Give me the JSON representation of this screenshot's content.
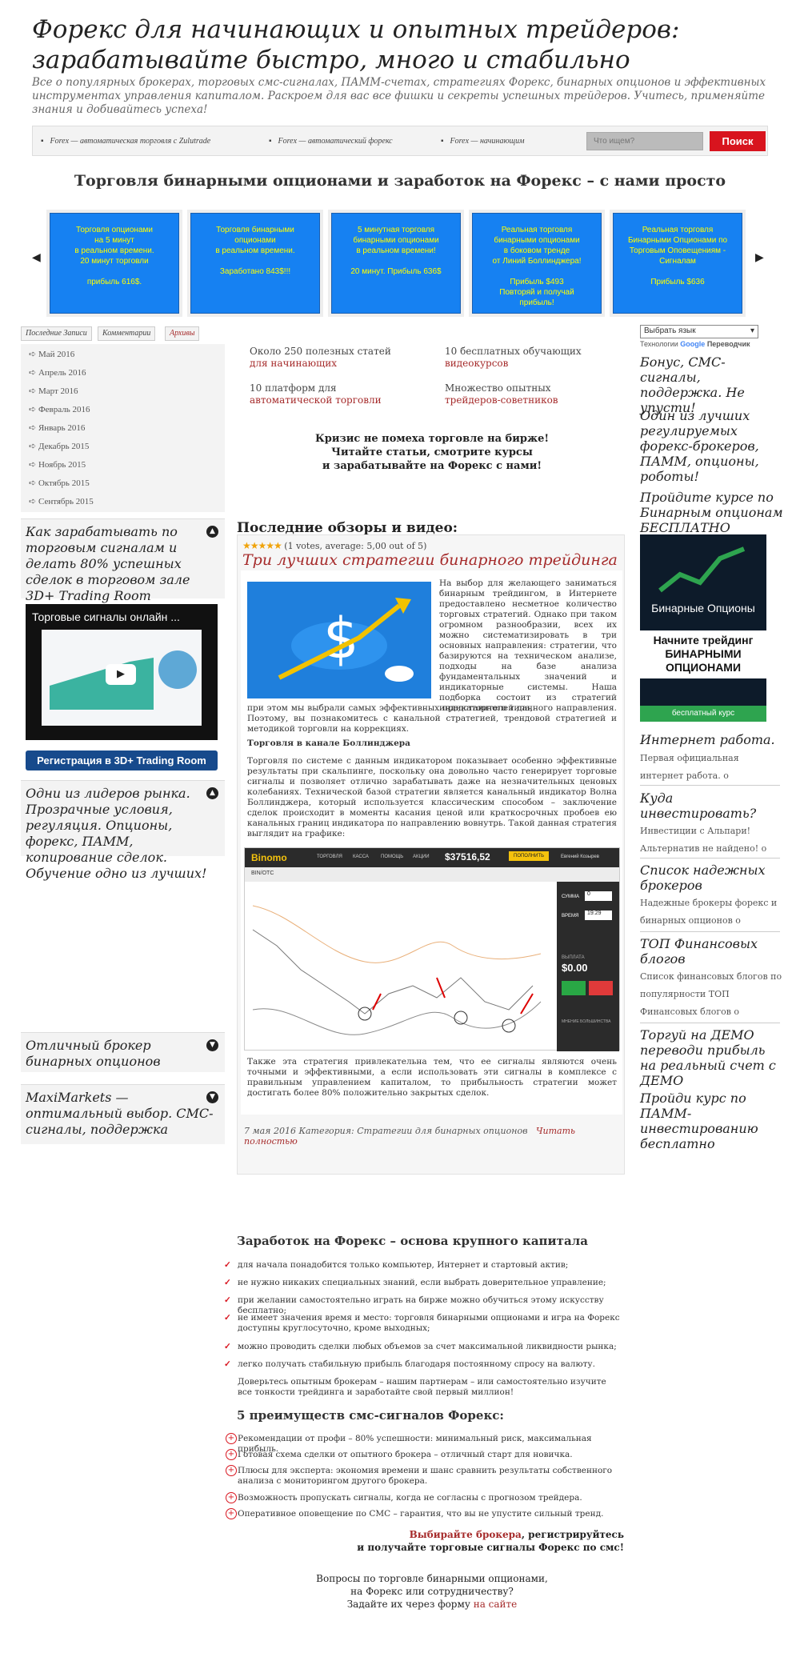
{
  "site": {
    "title": "Форекс для начинающих и опытных трейдеров: зарабатывайте быстро, много и стабильно",
    "description": "Все о популярных брокерах, торговых смс-сигналах, ПАММ-счетах, стратегиях Форекс, бинарных опционов и эффективных инструментах управления капиталом. Раскроем для вас все фишки и секреты успешных трейдеров. Учитесь, применяйте знания и добивайтесь успеха!"
  },
  "nav": {
    "items": [
      "Forex — автоматическая торговля с Zulutrade",
      "Forex — автоматический форекс",
      "Forex — начинающим"
    ],
    "search_placeholder": "Что ищем?",
    "search_button": "Поиск"
  },
  "headline": "Торговля бинарными опционами и заработок на Форекс – с нами просто",
  "carousel": {
    "prev": "◀",
    "next": "▶",
    "slides": [
      "Торговля опционами\nна 5 минут\nв реальном времени.\n20 минут торговли\n\nприбыль 616$.",
      "Торговля бинарными\nопционами\nв реальном времени.\n\nЗаработано 843$!!!",
      "5 минутная торговля\nбинарными опционами\nв реальном времени!\n\n20 минут. Прибыль 636$",
      "Реальная торговля\nбинарными опционами\nв боковом тренде\nот Линий Боллинджера!\n\nПрибыль $493\nПовторяй и получай\nприбыль!",
      "Реальная торговля\nБинарными Опционами по\nТорговым Оповещениям -\nСигналам\n\nПрибыль $636"
    ]
  },
  "left": {
    "tabs": [
      "Последние Записи",
      "Комментарии",
      "Архивы"
    ],
    "archives": [
      "Май 2016",
      "Апрель 2016",
      "Март 2016",
      "Февраль 2016",
      "Январь 2016",
      "Декабрь 2015",
      "Ноябрь 2015",
      "Октябрь 2015",
      "Сентябрь 2015"
    ],
    "widget1_title": "Как зарабатывать по торговым сигналам и делать 80% успешных сделок в торговом зале 3D+ Trading Room",
    "video_title": "Торговые сигналы онлайн ...",
    "register_button": "Регистрация в 3D+ Trading Room",
    "widget2_title": "Одни из лидеров рынка. Прозрачные условия, регуляция. Опционы, форекс, ПАММ, копирование сделок. Обучение одно из лучших!",
    "widget3_title": "Отличный брокер бинарных опционов",
    "widget4_title": "MaxiMarkets — оптимальный выбор. СМС-сигналы, поддержка"
  },
  "stats": {
    "s1_text": "Около 250 полезных статей ",
    "s1_link": "для начинающих",
    "s2_text": "10 бесплатных обучающих ",
    "s2_link": "видеокурсов",
    "s3_text": "10 платформ для ",
    "s3_link": "автоматической торговли",
    "s4_text": "Множество опытных ",
    "s4_link": "трейдеров-советников"
  },
  "crisis": {
    "line1": "Кризис не помеха торговле на бирже!",
    "line2": "Читайте статьи, смотрите курсы",
    "line3": "и зарабатывайте на Форекс с нами!"
  },
  "reviews": {
    "title": "Последние обзоры и видео:",
    "stars": "★★★★★",
    "rating_text": "(1 votes, average: 5,00 out of 5)",
    "post_title": "Три лучших стратегии бинарного трейдинга",
    "para1": "На выбор для желающего заниматься бинарным трейдингом, в Интернете предоставлено несметное количество торговых стратегий. Однако при таком огромном разнообразии, всех их можно систематизировать в три основных направления: стратегии, что базируются на техническом анализе, подходы на базе анализа фундаментальных значений и индикаторные системы. Наша подборка состоит из стратегий индикаторного типа,",
    "para1b": "при этом мы выбрали самых эффективных представителей данного направления. Поэтому, вы познакомитесь с канальной стратегией, трендовой стратегией и методикой торговли на коррекциях.",
    "subhead": "Торговля в канале Боллинджера",
    "para2": "Торговля по системе с данным индикатором показывает особенно эффективные результаты при скальпинге, поскольку она довольно часто генерирует торговые сигналы и позволяет отлично зарабатывать даже на незначительных ценовых колебаниях. Технической базой стратегии является канальный индикатор Волна Боллинджера, который используется классическим способом – заключение сделок происходит в моменты касания ценой или краткосрочных пробоев ею канальных границ индикатора по направлению вовнутрь. Такой данная стратегия выглядит на графике:",
    "chart_brand": "Binomo",
    "chart_menu": [
      "ТОРГОВЛЯ",
      "КАССА",
      "ПОМОЩЬ",
      "АКЦИИ"
    ],
    "chart_balance": "$37516,52",
    "chart_deposit": "ПОПОЛНИТЬ",
    "chart_user": "Евгений Козырев",
    "chart_symbol": "BIN/OTC",
    "chart_sum_label": "СУММА",
    "chart_sum_value": "0",
    "chart_time_label": "ВРЕМЯ",
    "chart_time_value": "19:29",
    "chart_payout_label": "ВЫПЛАТА",
    "chart_payout_value": "$0.00",
    "chart_mood_label": "МНЕНИЕ БОЛЬШИНСТВА",
    "para3": "Также эта стратегия привлекательна тем, что ее сигналы являются очень точными и эффективными, а если использовать эти сигналы в комплексе с правильным управлением капиталом, то прибыльность стратегии может достигать более 80% положительно закрытых сделок.",
    "meta": "7 мая 2016 Категория: Стратегии для бинарных опционов",
    "read_more": "Читать полностью"
  },
  "right": {
    "lang_select": "Выбрать язык",
    "lang_powered": "Технологии",
    "lang_brand": "Google",
    "lang_translate": "Переводчик",
    "w1": "Бонус, СМС-сигналы, поддержка. Не упусти!",
    "w2": "Один из лучших регулируемых форекс-брокеров, ПАММ, опционы, роботы!",
    "w3": "Пройдите курсе по Бинарным опционам БЕСПЛАТНО",
    "banner_brand": "Бинарные Опционы",
    "banner_cta": "Начните трейдинг БИНАРНЫМИ ОПЦИОНАМИ",
    "banner_foot": "бесплатный курс",
    "w4": "Интернет работа.",
    "w4_sub": "Первая официальная интернет работа. о",
    "w5": "Куда инвестировать?",
    "w5_sub1": "Инвестиции с Альпари!",
    "w5_sub2": "Альтернатив не найдено! о",
    "w6": "Список надежных брокеров",
    "w6_sub": "Надежные брокеры форекс и бинарных опционов о",
    "w7": "ТОП Финансовых блогов",
    "w7_sub": "Список финансовых блогов по популярности ТОП Финансовых блогов о",
    "w8": "Торгуй на ДЕМО переводи прибыль на реальный счет с ДЕМО",
    "w9": "Пройди курс по ПАММ-инвестированию бесплатно"
  },
  "forex": {
    "title": "Заработок на Форекс – основа крупного капитала",
    "items": [
      "для начала понадобится только компьютер, Интернет и стартовый актив;",
      "не нужно никаких специальных знаний, если выбрать доверительное управление;",
      "при желании самостоятельно играть на бирже можно обучиться этому искусству бесплатно;",
      "не имеет значения время и место: торговля бинарными опционами и игра на Форекс доступны круглосуточно, кроме выходных;",
      "можно проводить сделки любых объемов за счет максимальной ликвидности рынка;",
      "легко получать стабильную прибыль благодаря постоянному спросу на валюту."
    ],
    "closing": "Доверьтесь опытным брокерам – нашим партнерам – или самостоятельно изучите все тонкости трейдинга и заработайте свой первый миллион!"
  },
  "advantages": {
    "title": "5 преимуществ смс-сигналов Форекс:",
    "items": [
      "Рекомендации от профи – 80% успешности: минимальный риск, максимальная прибыль.",
      "Готовая схема сделки от опытного брокера – отличный старт для новичка.",
      "Плюсы для эксперта: экономия времени и шанс сравнить результаты собственного анализа с мониторингом другого брокера.",
      "Возможность пропускать сигналы, когда не согласны с прогнозом трейдера.",
      "Оперативное оповещение по СМС – гарантия, что вы не упустите сильный тренд."
    ]
  },
  "cta": {
    "link": "Выбирайте брокера",
    "line1_rest": ", регистрируйтесь",
    "line2": "и получайте торговые сигналы Форекс по смс!"
  },
  "questions": {
    "line1": "Вопросы по торговле бинарными опционами,",
    "line2": "на Форекс или сотрудничеству?",
    "line3": "Задайте их через форму ",
    "link": "на сайте"
  },
  "colors": {
    "accent": "#a52a2a",
    "button_red": "#d8141e",
    "slide_blue": "#1681f2",
    "slide_text": "#ffff00"
  }
}
